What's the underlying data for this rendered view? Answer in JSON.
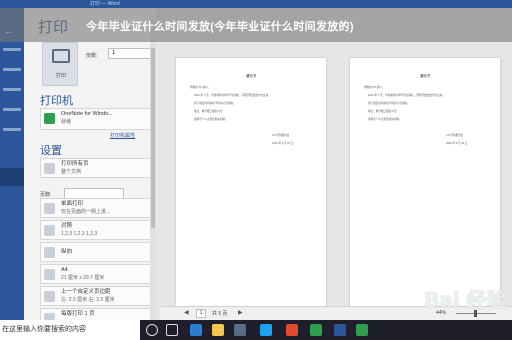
{
  "window": {
    "title_hint": "打印 — Word"
  },
  "headline": "今年毕业证什么时间发放(今年毕业证什么时间发放的)",
  "panel": {
    "title": "打印",
    "print_button_label": "打印",
    "copies_label": "份数:",
    "copies_value": "1",
    "printer_heading": "打印机",
    "printer_name": "OneNote for Windo...",
    "printer_status": "就绪",
    "printer_props_link": "打印机属性",
    "settings_heading": "设置",
    "settings": [
      {
        "title": "打印所有页",
        "sub": "整个文档"
      },
      {
        "title": "单面打印",
        "sub": "仅在页面的一侧上进..."
      },
      {
        "title": "对照",
        "sub": "1,2,3    1,2,3    1,2,3"
      },
      {
        "title": "纵向",
        "sub": ""
      },
      {
        "title": "A4",
        "sub": "21 厘米 x 29.7 厘米"
      },
      {
        "title": "上一个自定义页边距",
        "sub": "左: 2.5 厘米  右: 2.5 厘米"
      },
      {
        "title": "每版打印 1 页",
        "sub": ""
      }
    ],
    "pages_label": "页数:"
  },
  "preview": {
    "pages": [
      {
        "title": "通知书",
        "lines": [
          "尊敬的 XX 客户：",
          "2022 年 7 月，学校将准时举行毕业典礼，同期开始发放毕业证书。",
          "请于规定时间前往学院办公室领取。",
          "地点：教学楼三楼办公室",
          "请携带个人证件及相关材料。",
          "XX 学院教务处",
          "2022 年 6 月 20 日"
        ]
      },
      {
        "title": "通知书",
        "lines": [
          "尊敬的 XX 客户：",
          "2022 年 7 月，学校将准时举行毕业典礼，同期开始发放毕业证书。",
          "请于规定时间前往学院办公室领取。",
          "地点：教学楼三楼办公室",
          "请携带个人证件及相关材料。",
          "XX 学院教务处",
          "2022 年 6 月 20 日"
        ]
      }
    ]
  },
  "status": {
    "page_current": "1",
    "page_total": "共 5 页",
    "zoom": "44%"
  },
  "watermark": "Bai 经验",
  "taskbar": {
    "search_text": "在这里输入你要搜索的内容",
    "icons": [
      "search-icon",
      "task-view-icon",
      "edge-icon",
      "file-explorer-icon",
      "store-icon",
      "mail-icon",
      "photos-icon",
      "word-icon"
    ],
    "accent_colors": [
      "#1da1f2",
      "#2b7cd3",
      "#f2c94c",
      "#e04b2f",
      "#2e9e4e",
      "#2b579a"
    ]
  }
}
